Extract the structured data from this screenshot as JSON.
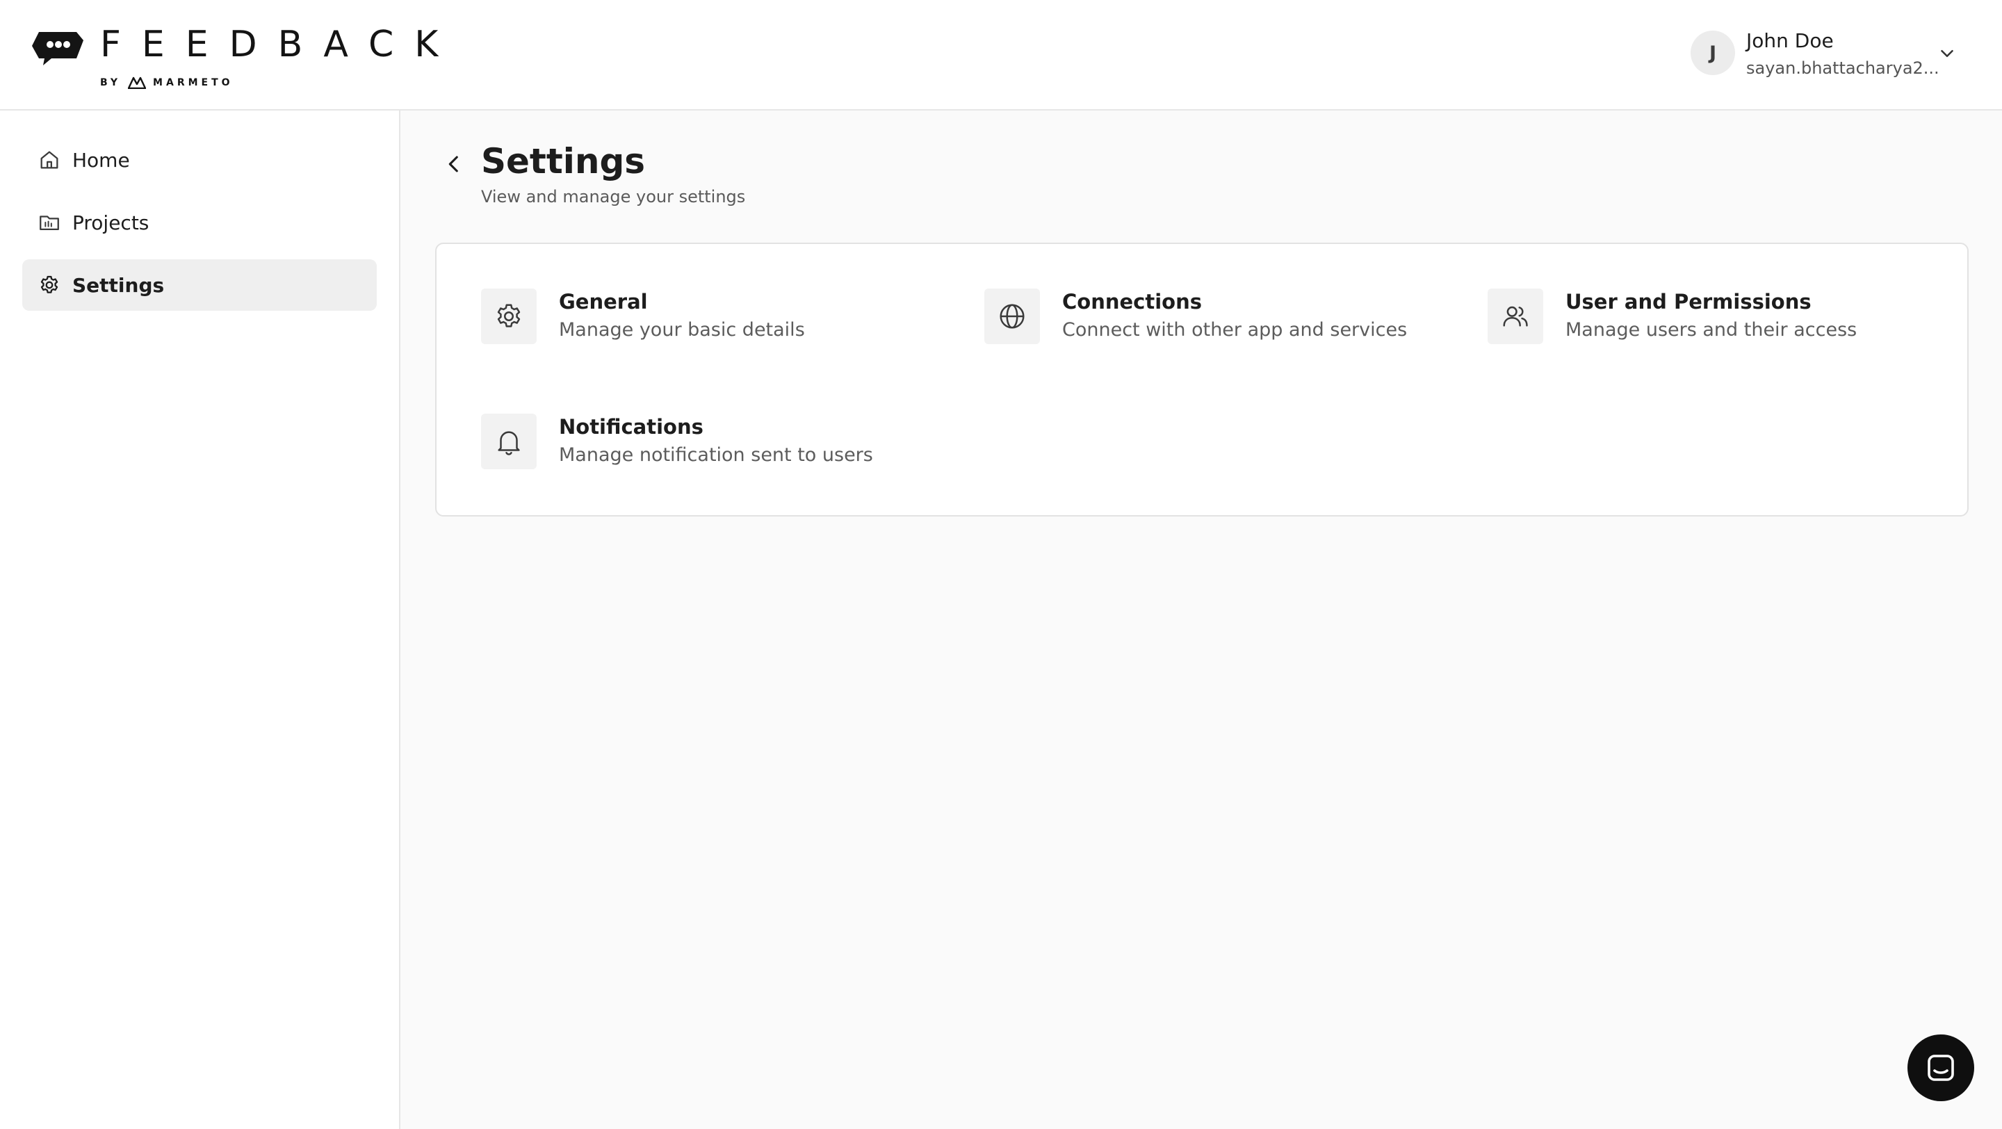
{
  "brand": {
    "name": "FEEDBACK",
    "by_text": "BY",
    "company": "MARMETO"
  },
  "user": {
    "initial": "J",
    "name": "John Doe",
    "email": "sayan.bhattacharya2...",
    "menu_icon": "chevron-down-icon"
  },
  "sidebar": {
    "items": [
      {
        "label": "Home",
        "icon": "home-icon",
        "active": false
      },
      {
        "label": "Projects",
        "icon": "folder-icon",
        "active": false
      },
      {
        "label": "Settings",
        "icon": "gear-icon",
        "active": true
      }
    ]
  },
  "page": {
    "title": "Settings",
    "subtitle": "View and manage your settings",
    "back_icon": "chevron-left-icon"
  },
  "settings": [
    {
      "title": "General",
      "description": "Manage your basic details",
      "icon": "gear-icon"
    },
    {
      "title": "Connections",
      "description": "Connect with other app and services",
      "icon": "globe-icon"
    },
    {
      "title": "User and Permissions",
      "description": "Manage users and their access",
      "icon": "users-icon"
    },
    {
      "title": "Notifications",
      "description": "Manage notification sent to users",
      "icon": "bell-icon"
    }
  ],
  "chat": {
    "icon": "chat-icon"
  },
  "colors": {
    "sidebar_active_bg": "#efefef",
    "main_bg": "#fafafa",
    "icon_box_bg": "#f2f2f2",
    "chat_button": "#0f0f0f"
  }
}
